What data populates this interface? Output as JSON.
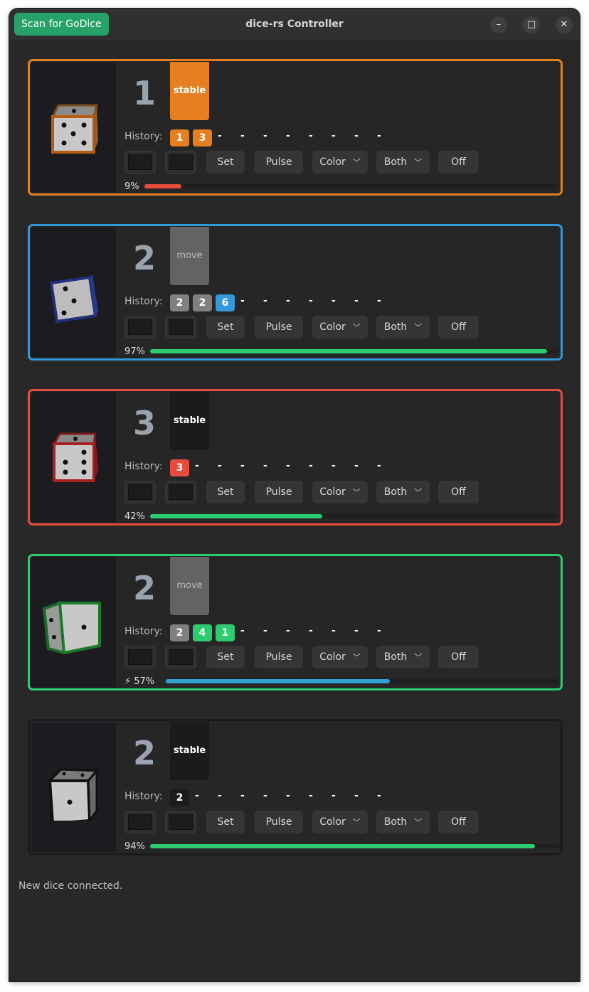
{
  "window": {
    "title": "dice-rs Controller",
    "scan_label": "Scan for GoDice",
    "minimize_glyph": "–",
    "maximize_glyph": "□",
    "close_glyph": "✕"
  },
  "labels": {
    "history": "History:",
    "set": "Set",
    "pulse": "Pulse",
    "color": "Color",
    "both": "Both",
    "off": "Off",
    "dash": "-"
  },
  "colors": {
    "orange": "#e67e22",
    "blue": "#3498db",
    "red": "#e74c3c",
    "green": "#2ecc71",
    "gray": "#808080",
    "black": "#1b1b1b",
    "battery_green": "#2ecc71",
    "battery_low": "#e74c3c",
    "battery_charging": "#33a0d0"
  },
  "dice": [
    {
      "value": "1",
      "state": "stable",
      "border_color": "#e67e22",
      "history": [
        {
          "value": "1",
          "color": "#e67e22"
        },
        {
          "value": "3",
          "color": "#e67e22"
        }
      ],
      "history_dashes": 8,
      "battery_text": "9%",
      "battery": 0.09,
      "charging": false
    },
    {
      "value": "2",
      "state": "move",
      "border_color": "#3498db",
      "history": [
        {
          "value": "2",
          "color": "#808080"
        },
        {
          "value": "2",
          "color": "#808080"
        },
        {
          "value": "6",
          "color": "#3498db"
        }
      ],
      "history_dashes": 7,
      "battery_text": "97%",
      "battery": 0.97,
      "charging": false
    },
    {
      "value": "3",
      "state": "stable",
      "border_color": "#e74c3c",
      "history": [
        {
          "value": "3",
          "color": "#e74c3c"
        }
      ],
      "history_dashes": 9,
      "battery_text": "42%",
      "battery": 0.42,
      "charging": false
    },
    {
      "value": "2",
      "state": "move",
      "border_color": "#2ecc71",
      "history": [
        {
          "value": "2",
          "color": "#808080"
        },
        {
          "value": "4",
          "color": "#2ecc71"
        },
        {
          "value": "1",
          "color": "#2ecc71"
        }
      ],
      "history_dashes": 7,
      "battery_text": "⚡ 57%",
      "battery": 0.57,
      "charging": true
    },
    {
      "value": "2",
      "state": "stable",
      "border_color": "#1b1b1b",
      "history": [
        {
          "value": "2",
          "color": "#1b1b1b"
        }
      ],
      "history_dashes": 9,
      "battery_text": "94%",
      "battery": 0.94,
      "charging": false
    }
  ],
  "status_text": "New dice connected."
}
